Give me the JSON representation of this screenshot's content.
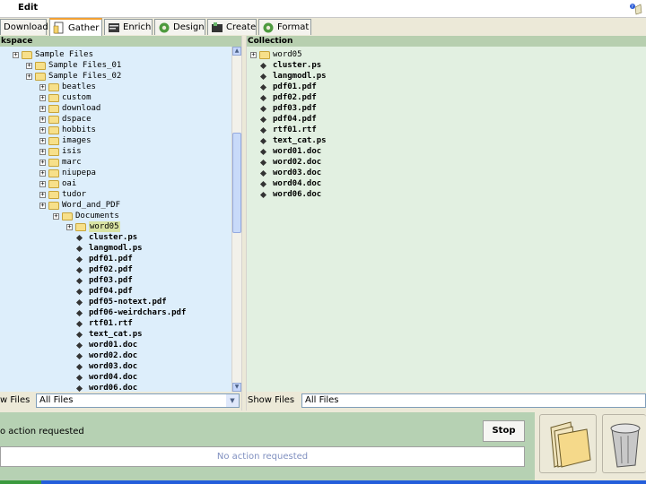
{
  "menubar": {
    "edit_label": "Edit"
  },
  "tabs": [
    {
      "label": "Download",
      "icon": "download-icon",
      "active": false
    },
    {
      "label": "Gather",
      "icon": "gather-icon",
      "active": true
    },
    {
      "label": "Enrich",
      "icon": "enrich-icon",
      "active": false
    },
    {
      "label": "Design",
      "icon": "design-icon",
      "active": false
    },
    {
      "label": "Create",
      "icon": "create-icon",
      "active": false
    },
    {
      "label": "Format",
      "icon": "format-icon",
      "active": false
    }
  ],
  "workspace": {
    "header": "kspace",
    "tree": [
      {
        "label": "Sample Files",
        "type": "folder",
        "depth": 0
      },
      {
        "label": "Sample Files_01",
        "type": "folder",
        "depth": 1
      },
      {
        "label": "Sample Files_02",
        "type": "folder",
        "depth": 1
      },
      {
        "label": "beatles",
        "type": "folder",
        "depth": 2
      },
      {
        "label": "custom",
        "type": "folder",
        "depth": 2
      },
      {
        "label": "download",
        "type": "folder",
        "depth": 2
      },
      {
        "label": "dspace",
        "type": "folder",
        "depth": 2
      },
      {
        "label": "hobbits",
        "type": "folder",
        "depth": 2
      },
      {
        "label": "images",
        "type": "folder",
        "depth": 2
      },
      {
        "label": "isis",
        "type": "folder",
        "depth": 2
      },
      {
        "label": "marc",
        "type": "folder",
        "depth": 2
      },
      {
        "label": "niupepa",
        "type": "folder",
        "depth": 2
      },
      {
        "label": "oai",
        "type": "folder",
        "depth": 2
      },
      {
        "label": "tudor",
        "type": "folder",
        "depth": 2
      },
      {
        "label": "Word_and_PDF",
        "type": "folder",
        "depth": 2
      },
      {
        "label": "Documents",
        "type": "folder",
        "depth": 3
      },
      {
        "label": "word05",
        "type": "folder",
        "depth": 4,
        "selected": true
      },
      {
        "label": "cluster.ps",
        "type": "file",
        "depth": 4
      },
      {
        "label": "langmodl.ps",
        "type": "file",
        "depth": 4
      },
      {
        "label": "pdf01.pdf",
        "type": "file",
        "depth": 4
      },
      {
        "label": "pdf02.pdf",
        "type": "file",
        "depth": 4
      },
      {
        "label": "pdf03.pdf",
        "type": "file",
        "depth": 4
      },
      {
        "label": "pdf04.pdf",
        "type": "file",
        "depth": 4
      },
      {
        "label": "pdf05-notext.pdf",
        "type": "file",
        "depth": 4
      },
      {
        "label": "pdf06-weirdchars.pdf",
        "type": "file",
        "depth": 4
      },
      {
        "label": "rtf01.rtf",
        "type": "file",
        "depth": 4
      },
      {
        "label": "text_cat.ps",
        "type": "file",
        "depth": 4
      },
      {
        "label": "word01.doc",
        "type": "file",
        "depth": 4
      },
      {
        "label": "word02.doc",
        "type": "file",
        "depth": 4
      },
      {
        "label": "word03.doc",
        "type": "file",
        "depth": 4
      },
      {
        "label": "word04.doc",
        "type": "file",
        "depth": 4
      },
      {
        "label": "word06.doc",
        "type": "file",
        "depth": 4
      }
    ],
    "filter_label": "w Files",
    "filter_value": "All Files"
  },
  "collection": {
    "header": "Collection",
    "tree": [
      {
        "label": "word05",
        "type": "folder",
        "depth": 0
      },
      {
        "label": "cluster.ps",
        "type": "file",
        "depth": 0
      },
      {
        "label": "langmodl.ps",
        "type": "file",
        "depth": 0
      },
      {
        "label": "pdf01.pdf",
        "type": "file",
        "depth": 0
      },
      {
        "label": "pdf02.pdf",
        "type": "file",
        "depth": 0
      },
      {
        "label": "pdf03.pdf",
        "type": "file",
        "depth": 0
      },
      {
        "label": "pdf04.pdf",
        "type": "file",
        "depth": 0
      },
      {
        "label": "rtf01.rtf",
        "type": "file",
        "depth": 0
      },
      {
        "label": "text_cat.ps",
        "type": "file",
        "depth": 0
      },
      {
        "label": "word01.doc",
        "type": "file",
        "depth": 0
      },
      {
        "label": "word02.doc",
        "type": "file",
        "depth": 0
      },
      {
        "label": "word03.doc",
        "type": "file",
        "depth": 0
      },
      {
        "label": "word04.doc",
        "type": "file",
        "depth": 0
      },
      {
        "label": "word06.doc",
        "type": "file",
        "depth": 0
      }
    ],
    "filter_label": "Show Files",
    "filter_value": "All Files"
  },
  "status": {
    "text": "o action requested",
    "stop_label": "Stop",
    "progress_text": "No action requested"
  },
  "actions": {
    "open_icon": "folder-open-icon",
    "trash_icon": "trash-can-icon"
  },
  "colors": {
    "workspace_bg": "#ddeefb",
    "collection_bg": "#e2f0e1",
    "header_bg": "#b7cfaf",
    "status_bg": "#b6d1b3",
    "active_tab_accent": "#f2a032"
  }
}
